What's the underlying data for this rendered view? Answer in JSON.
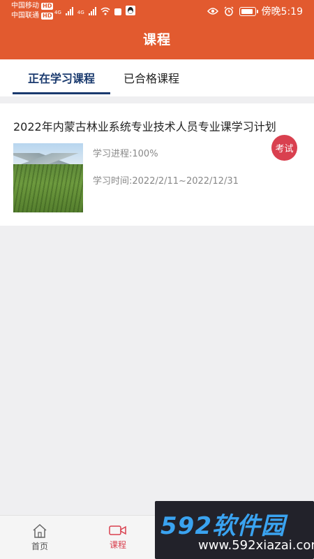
{
  "status_bar": {
    "carrier_1": "中国移动",
    "carrier_2": "中国联通",
    "hd_badge": "HD",
    "net_1": "4G",
    "net_2": "4G",
    "time": "傍晚5:19"
  },
  "header": {
    "title": "课程"
  },
  "tabs": [
    {
      "label": "正在学习课程",
      "active": true
    },
    {
      "label": "已合格课程",
      "active": false
    }
  ],
  "course": {
    "title": "2022年内蒙古林业系统专业技术人员专业课学习计划",
    "progress_label": "学习进程:",
    "progress_value": "100%",
    "period_label": "学习时间:",
    "period_value": "2022/2/11~2022/12/31",
    "exam_label": "考试"
  },
  "bottom_nav": {
    "home_label": "首页",
    "course_label": "课程"
  },
  "watermark": {
    "big": "592软件园",
    "small": "www.592xiazai.com"
  },
  "colors": {
    "header_bg": "#e25a2f",
    "tab_active": "#1a3a6e",
    "exam_badge": "#d9404f",
    "nav_active": "#d9404f"
  }
}
